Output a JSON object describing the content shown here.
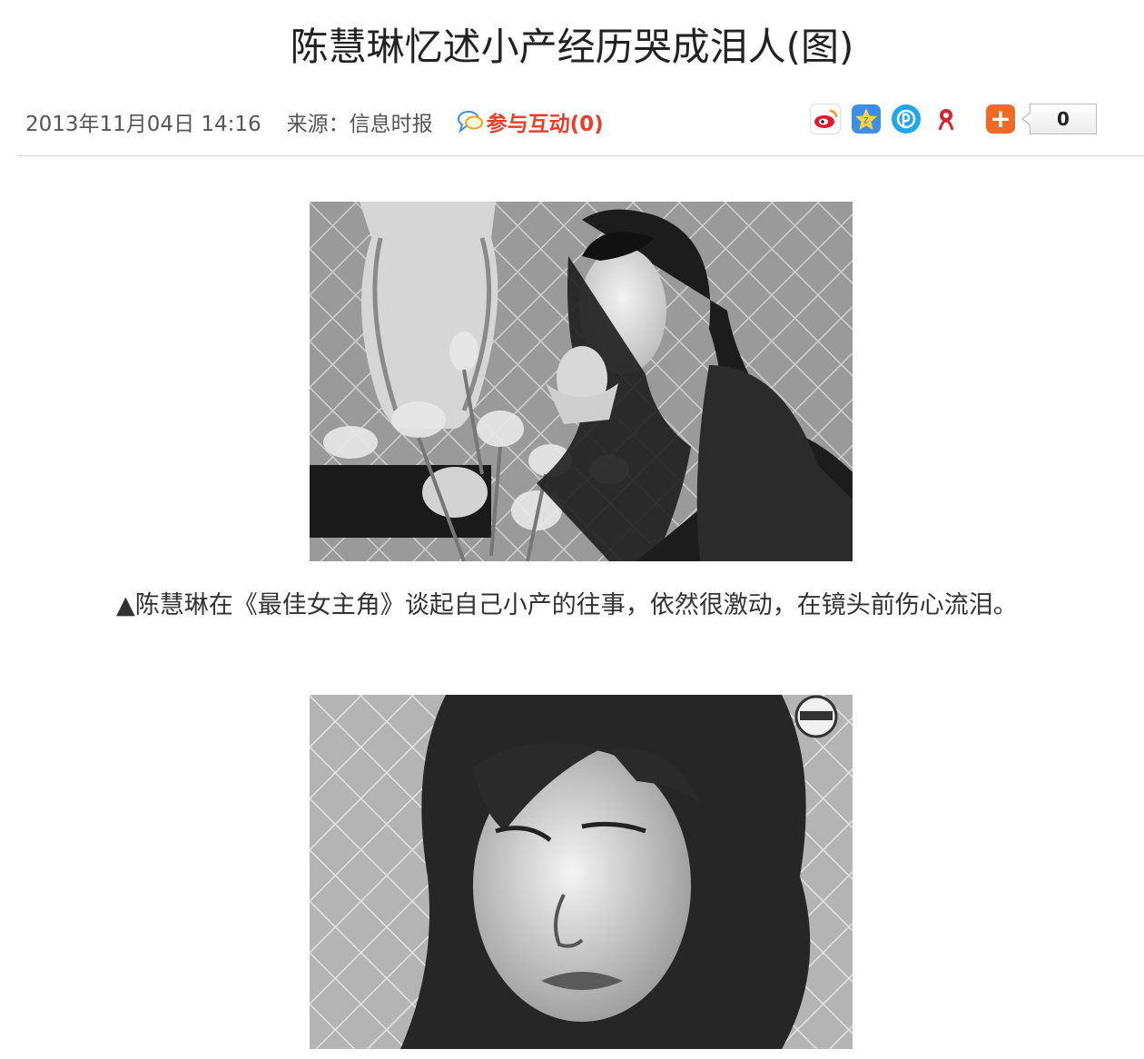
{
  "article": {
    "title": "陈慧琳忆述小产经历哭成泪人(图)",
    "date": "2013年11月04日 14:16",
    "source_label": "来源：信息时报",
    "interact_label": "参与互动(0)",
    "caption": "▲陈慧琳在《最佳女主角》谈起自己小产的往事，依然很激动，在镜头前伤心流泪。"
  },
  "share": {
    "icons": [
      "weibo-icon",
      "qzone-icon",
      "tencent-weibo-icon",
      "renren-icon",
      "add-share-icon"
    ],
    "count": "0"
  },
  "colors": {
    "interact": "#e4402a",
    "add_button": "#f06a26",
    "divider": "#d8d8d8"
  }
}
